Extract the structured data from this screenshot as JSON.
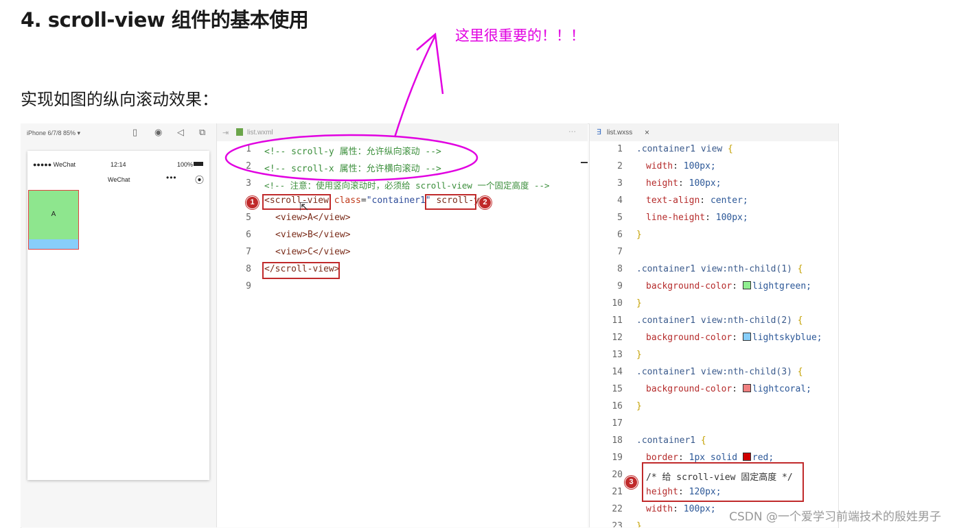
{
  "heading": "4. scroll-view 组件的基本使用",
  "annotation_note": "这里很重要的！！！",
  "subtitle": "实现如图的纵向滚动效果：",
  "watermark": "CSDN @一个爱学习前端技术的殷姓男子",
  "colors": {
    "annotation": "#e100e1",
    "highlight_box": "#c0292a"
  },
  "simulator": {
    "device_label": "iPhone 6/7/8 85% ▾",
    "status": {
      "carrier": "●●●●● WeChat",
      "time": "12:14",
      "battery": "100%"
    },
    "nav_title": "WeChat",
    "capsule_more": "•••",
    "scroll_item_a": "A"
  },
  "wxml_editor": {
    "tab_label": "list.wxml",
    "more": "···",
    "lines": [
      {
        "n": "1",
        "text": "<!-- scroll-y 属性：允许纵向滚动 -->"
      },
      {
        "n": "2",
        "text": "<!-- scroll-x 属性：允许横向滚动 -->"
      },
      {
        "n": "3",
        "text": "<!-- 注意：使用竖向滚动时，必须给 scroll-view 一个固定高度 -->"
      },
      {
        "n": "4",
        "tag_open": "<scroll-view",
        "attr": "class",
        "eq": "=",
        "str": "\"container1\"",
        "attr2": "scroll-y>"
      },
      {
        "n": "5",
        "text": "<view>A</view>"
      },
      {
        "n": "6",
        "text": "<view>B</view>"
      },
      {
        "n": "7",
        "text": "<view>C</view>"
      },
      {
        "n": "8",
        "text": "</scroll-view>"
      },
      {
        "n": "9",
        "text": ""
      }
    ],
    "badges": [
      "1",
      "2"
    ]
  },
  "wxss_editor": {
    "tab_label": "list.wxss",
    "close": "×",
    "lines": [
      {
        "n": "1",
        "sel": ".container1 view",
        "tail": " {"
      },
      {
        "n": "2",
        "prop": "width",
        "val": "100px;"
      },
      {
        "n": "3",
        "prop": "height",
        "val": "100px;"
      },
      {
        "n": "4",
        "prop": "text-align",
        "val": "center;"
      },
      {
        "n": "5",
        "prop": "line-height",
        "val": "100px;"
      },
      {
        "n": "6",
        "brace": "}"
      },
      {
        "n": "7"
      },
      {
        "n": "8",
        "sel": ".container1 view:nth-child(1)",
        "tail": " {"
      },
      {
        "n": "9",
        "prop": "background-color",
        "val": "lightgreen;",
        "swatch": "#90ee90"
      },
      {
        "n": "10",
        "brace": "}"
      },
      {
        "n": "11",
        "sel": ".container1 view:nth-child(2)",
        "tail": " {"
      },
      {
        "n": "12",
        "prop": "background-color",
        "val": "lightskyblue;",
        "swatch": "#87cefa"
      },
      {
        "n": "13",
        "brace": "}"
      },
      {
        "n": "14",
        "sel": ".container1 view:nth-child(3)",
        "tail": " {"
      },
      {
        "n": "15",
        "prop": "background-color",
        "val": "lightcoral;",
        "swatch": "#f08080"
      },
      {
        "n": "16",
        "brace": "}"
      },
      {
        "n": "17"
      },
      {
        "n": "18",
        "sel": ".container1",
        "tail": " {"
      },
      {
        "n": "19",
        "prop": "border",
        "val": "1px solid ",
        "swatch": "#d00000",
        "val2": "red;"
      },
      {
        "n": "20",
        "comment": "/* 给 scroll-view 固定高度 */"
      },
      {
        "n": "21",
        "prop": "height",
        "val": "120px;"
      },
      {
        "n": "22",
        "prop": "width",
        "val": "100px;"
      },
      {
        "n": "23",
        "brace": "}"
      }
    ],
    "badge": "3"
  }
}
